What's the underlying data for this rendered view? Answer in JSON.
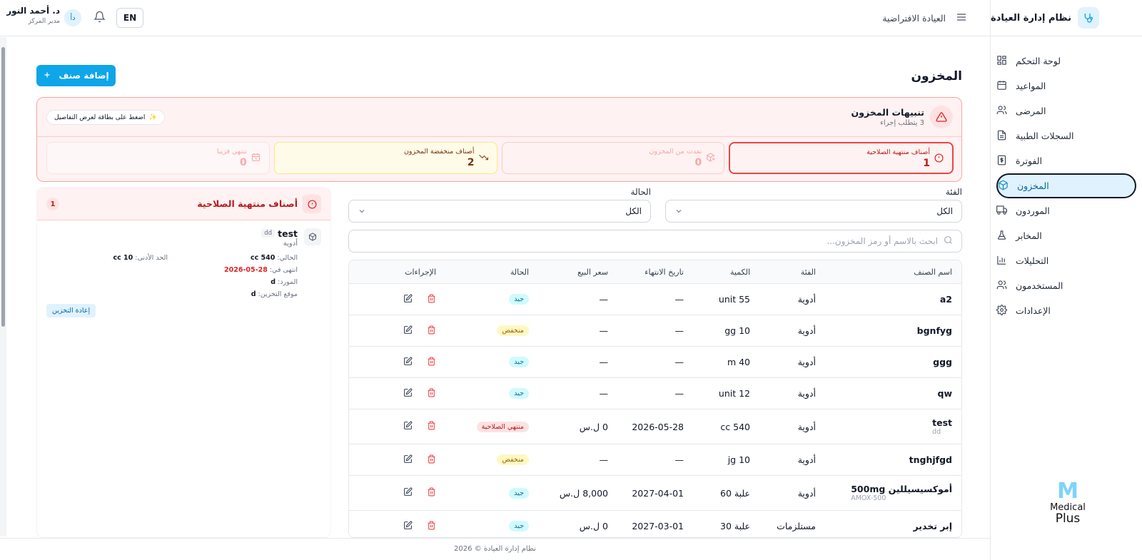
{
  "app": {
    "title": "نظام إدارة العيادة"
  },
  "sidebar": {
    "items": [
      {
        "label": "لوحة التحكم",
        "icon": "dashboard-icon"
      },
      {
        "label": "المواعيد",
        "icon": "calendar-icon"
      },
      {
        "label": "المرضى",
        "icon": "users-icon"
      },
      {
        "label": "السجلات الطبية",
        "icon": "file-icon"
      },
      {
        "label": "الفوترة",
        "icon": "dollar-icon"
      },
      {
        "label": "المخزون",
        "icon": "package-icon",
        "active": true
      },
      {
        "label": "الموردون",
        "icon": "truck-icon"
      },
      {
        "label": "المخابر",
        "icon": "flask-icon"
      },
      {
        "label": "التحليلات",
        "icon": "bar-chart-icon"
      },
      {
        "label": "المستخدمون",
        "icon": "users-icon"
      },
      {
        "label": "الإعدادات",
        "icon": "gear-icon"
      }
    ],
    "logo_mark": "M",
    "logo_line1": "Medical",
    "logo_line2": "Plus"
  },
  "topbar": {
    "clinic": "العيادة الافتراضية",
    "lang": "EN",
    "avatar": "دأ",
    "user_name": "د. أحمد النور",
    "user_role": "مدير المركز"
  },
  "page": {
    "title": "المخزون",
    "add_button": "إضافة صنف"
  },
  "alerts": {
    "title": "تنبيهات المخزون",
    "subtitle": "3 يتطلب إجراء",
    "hint": "اضغط على بطاقة لعرض التفاصيل",
    "cards": [
      {
        "label": "أصناف منتهية الصلاحية",
        "value": "1"
      },
      {
        "label": "نفدت من المخزون",
        "value": "0"
      },
      {
        "label": "أصناف منخفضة المخزون",
        "value": "2"
      },
      {
        "label": "تنتهي قريبا",
        "value": "0"
      }
    ]
  },
  "filters": {
    "category_label": "الفئة",
    "category_value": "الكل",
    "status_label": "الحالة",
    "status_value": "الكل",
    "search_placeholder": "ابحث بالاسم أو رمز المخزون..."
  },
  "table": {
    "headers": {
      "name": "اسم الصنف",
      "category": "الفئة",
      "quantity": "الكمية",
      "expiry": "تاريخ الانتهاء",
      "price": "سعر البيع",
      "status": "الحالة",
      "actions": "الإجراءات"
    },
    "rows": [
      {
        "name": "a2",
        "code": "",
        "category": "أدوية",
        "quantity": "unit 55",
        "expiry": "—",
        "price": "—",
        "status": "جيد",
        "status_type": "good"
      },
      {
        "name": "bgnfyg",
        "code": "",
        "category": "أدوية",
        "quantity": "gg 10",
        "expiry": "—",
        "price": "—",
        "status": "منخفض",
        "status_type": "low"
      },
      {
        "name": "ggg",
        "code": "",
        "category": "أدوية",
        "quantity": "m 40",
        "expiry": "—",
        "price": "—",
        "status": "جيد",
        "status_type": "good"
      },
      {
        "name": "qw",
        "code": "",
        "category": "أدوية",
        "quantity": "unit 12",
        "expiry": "—",
        "price": "—",
        "status": "جيد",
        "status_type": "good"
      },
      {
        "name": "test",
        "code": "dd",
        "category": "أدوية",
        "quantity": "cc 540",
        "expiry": "2026-05-28",
        "price": "0 ل.س",
        "status": "منتهي الصلاحية",
        "status_type": "exp"
      },
      {
        "name": "tnghjfgd",
        "code": "",
        "category": "أدوية",
        "quantity": "jg 10",
        "expiry": "—",
        "price": "—",
        "status": "منخفض",
        "status_type": "low"
      },
      {
        "name": "أموكسيسيللين 500mg",
        "code": "AMOX-500",
        "category": "أدوية",
        "quantity": "60 علبة",
        "expiry": "2027-04-01",
        "price": "8,000 ل.س",
        "status": "جيد",
        "status_type": "good"
      },
      {
        "name": "إبر تخدير",
        "code": "",
        "category": "مستلزمات",
        "quantity": "30 علبة",
        "expiry": "2027-03-01",
        "price": "0 ل.س",
        "status": "جيد",
        "status_type": "good"
      }
    ]
  },
  "panel": {
    "title": "أصناف منتهية الصلاحية",
    "count": "1",
    "item": {
      "name": "test",
      "code": "dd",
      "category": "أدوية",
      "current_label": "الحالي:",
      "current_value": "cc 540",
      "min_label": "الحد الأدنى:",
      "min_value": "cc 10",
      "expired_label": "انتهى في:",
      "expired_value": "28-05-2026",
      "supplier_label": "المورد:",
      "supplier_value": "d",
      "location_label": "موقع التخزين:",
      "location_value": "d",
      "restock": "إعادة التخزين"
    }
  },
  "footer": {
    "text": "نظام إدارة العيادة © 2026"
  }
}
